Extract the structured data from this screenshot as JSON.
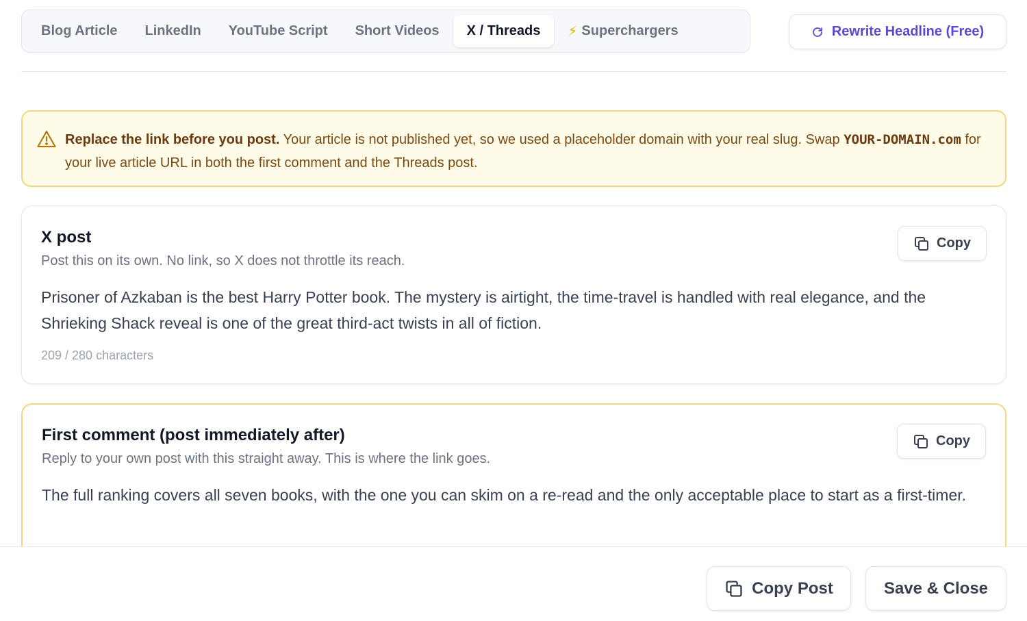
{
  "tabs": [
    {
      "label": "Blog Article",
      "active": false
    },
    {
      "label": "LinkedIn",
      "active": false
    },
    {
      "label": "YouTube Script",
      "active": false
    },
    {
      "label": "Short Videos",
      "active": false
    },
    {
      "label": "X / Threads",
      "active": true
    },
    {
      "label": "Superchargers",
      "active": false,
      "icon": "lightning-icon"
    }
  ],
  "header": {
    "rewrite_label": "Rewrite Headline (Free)",
    "rewrite_icon": "refresh-icon"
  },
  "warning": {
    "bold": "Replace the link before you post.",
    "text_before": " Your article is not published yet, so we used a placeholder domain with your real slug. Swap ",
    "code": "YOUR-DOMAIN.com",
    "text_after": " for your live article URL in both the first comment and the Threads post.",
    "icon": "warning-triangle-icon"
  },
  "x_post": {
    "title": "X post",
    "subtitle": "Post this on its own. No link, so X does not throttle its reach.",
    "body": "Prisoner of Azkaban is the best Harry Potter book. The mystery is airtight, the time-travel is handled with real elegance, and the Shrieking Shack reveal is one of the great third-act twists in all of fiction.",
    "count": "209 / 280 characters",
    "copy_label": "Copy"
  },
  "first_comment": {
    "title": "First comment (post immediately after)",
    "subtitle": "Reply to your own post with this straight away. This is where the link goes.",
    "body": "The full ranking covers all seven books, with the one you can skim on a re-read and the only acceptable place to start as a first-timer.",
    "copy_label": "Copy"
  },
  "footer": {
    "copy_post_label": "Copy Post",
    "save_close_label": "Save & Close"
  },
  "colors": {
    "accent": "#5b47d6",
    "warning_bg": "#fefbe8",
    "warning_border": "#f4d77a",
    "bolt": "#f5b301"
  }
}
